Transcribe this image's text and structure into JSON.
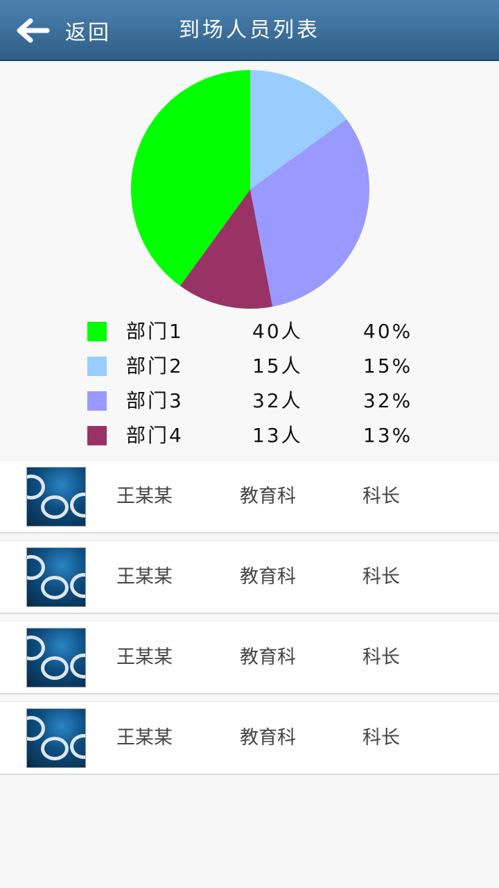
{
  "header": {
    "back_label": "返回",
    "title": "到场人员列表"
  },
  "chart_data": {
    "type": "pie",
    "title": "",
    "categories": [
      "部门1",
      "部门2",
      "部门3",
      "部门4"
    ],
    "values": [
      40,
      15,
      32,
      13
    ],
    "counts": [
      "40人",
      "15人",
      "32人",
      "13人"
    ],
    "percents": [
      "40%",
      "15%",
      "32%",
      "13%"
    ],
    "colors": [
      "#00ff00",
      "#99ccff",
      "#9999ff",
      "#993366"
    ],
    "display_order": [
      1,
      2,
      3,
      0
    ],
    "legend_position": "bottom"
  },
  "people": [
    {
      "name": "王某某",
      "dept": "教育科",
      "title": "科长"
    },
    {
      "name": "王某某",
      "dept": "教育科",
      "title": "科长"
    },
    {
      "name": "王某某",
      "dept": "教育科",
      "title": "科长"
    },
    {
      "name": "王某某",
      "dept": "教育科",
      "title": "科长"
    }
  ]
}
